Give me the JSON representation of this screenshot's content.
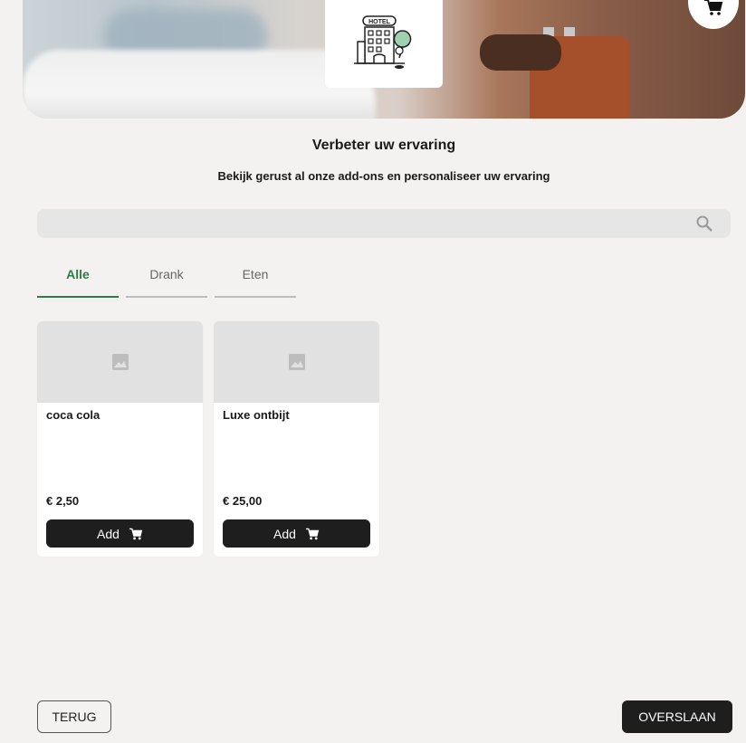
{
  "header": {
    "logo_text": "HOTEL",
    "cart_icon": "shopping-cart-icon"
  },
  "intro": {
    "title": "Verbeter uw ervaring",
    "subtitle": "Bekijk gerust al onze add-ons en personaliseer uw ervaring"
  },
  "search": {
    "value": "",
    "placeholder": "",
    "icon": "search-icon"
  },
  "tabs": [
    {
      "label": "Alle",
      "active": true
    },
    {
      "label": "Drank",
      "active": false
    },
    {
      "label": "Eten",
      "active": false
    }
  ],
  "products": [
    {
      "name": "coca cola",
      "price": "€ 2,50",
      "button": "Add",
      "image_icon": "image-placeholder-icon"
    },
    {
      "name": "Luxe ontbijt",
      "price": "€ 25,00",
      "button": "Add",
      "image_icon": "image-placeholder-icon"
    }
  ],
  "footer": {
    "back_label": "TERUG",
    "skip_label": "OVERSLAAN"
  },
  "colors": {
    "accent": "#2e7a4b",
    "button_dark": "#1e1e1e",
    "background": "#f4f2f0"
  }
}
